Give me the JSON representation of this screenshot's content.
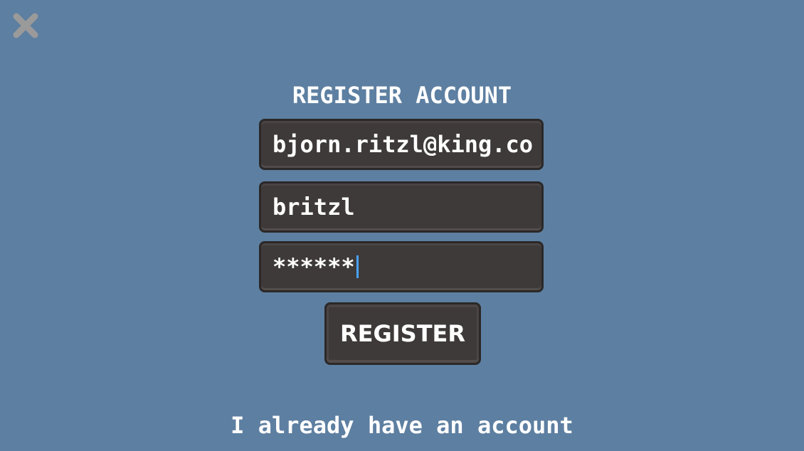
{
  "screen": {
    "title": "REGISTER ACCOUNT",
    "background_color": "#5d7fa1"
  },
  "close": {
    "icon": "close-icon",
    "color": "#9a9a9a"
  },
  "form": {
    "email_value": "bjorn.ritzl@king.co",
    "username_value": "britzl",
    "password_value": "******",
    "field_color": "#3e3a39",
    "caret_color": "#4aa3ff"
  },
  "actions": {
    "register_label": "REGISTER",
    "login_link_label": "I already have an account"
  }
}
